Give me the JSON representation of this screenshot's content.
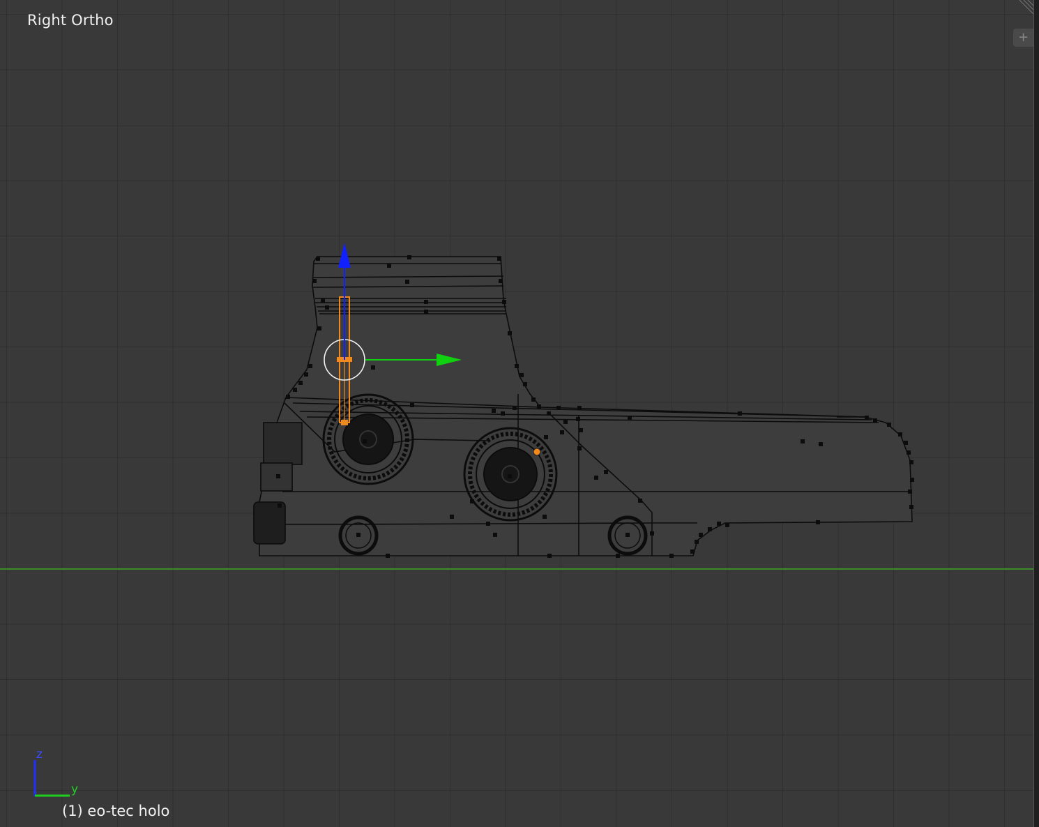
{
  "viewport": {
    "view_title": "Right Ortho",
    "object_info": "(1) eo-tec holo",
    "add_region_icon": "plus-icon"
  },
  "axis_gizmo": {
    "vertical_axis": "z",
    "horizontal_axis": "y",
    "vertical_color": "#1f2fff",
    "horizontal_color": "#1fcf1f"
  },
  "colors": {
    "background": "#393939",
    "selection": "#f08a1d",
    "manipulator_up": "#1020ff",
    "manipulator_right": "#10d010",
    "horizon": "#3b8a2b"
  }
}
